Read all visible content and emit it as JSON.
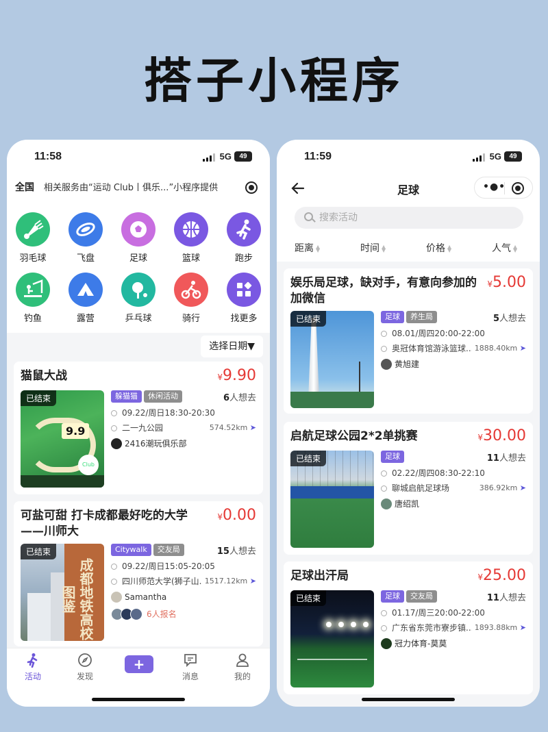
{
  "poster_title": "搭子小程序",
  "left": {
    "time": "11:58",
    "network": "5G",
    "battery": "49",
    "region": "全国",
    "notice": "相关服务由“运动 Club丨俱乐...”小程序提供",
    "categories": [
      {
        "label": "羽毛球",
        "icon": "badminton-icon",
        "color": "#2fbf7a"
      },
      {
        "label": "飞盘",
        "icon": "frisbee-icon",
        "color": "#3d7be8"
      },
      {
        "label": "足球",
        "icon": "soccer-ball-icon",
        "color": "#c86ee0"
      },
      {
        "label": "篮球",
        "icon": "basketball-icon",
        "color": "#7a58e2"
      },
      {
        "label": "跑步",
        "icon": "running-icon",
        "color": "#7a58e2"
      },
      {
        "label": "钓鱼",
        "icon": "fishing-icon",
        "color": "#2fbf7a"
      },
      {
        "label": "露营",
        "icon": "tent-icon",
        "color": "#3d7be8"
      },
      {
        "label": "乒乓球",
        "icon": "ping-pong-icon",
        "color": "#22b8a0"
      },
      {
        "label": "骑行",
        "icon": "cycling-icon",
        "color": "#f0585a"
      },
      {
        "label": "找更多",
        "icon": "grid-more-icon",
        "color": "#7a58e2"
      }
    ],
    "date_filter": "选择日期▼",
    "events": [
      {
        "title": "猫鼠大战",
        "price_symbol": "¥",
        "price": "9.90",
        "status": "已结束",
        "tags": [
          "躲猫猫",
          "休闲活动"
        ],
        "want_count": "6",
        "want_suffix": "人想去",
        "time": "09.22/周日18:30-20:30",
        "place": "二一九公园",
        "distance": "574.52km",
        "organizer": "2416潮玩俱乐部"
      },
      {
        "title": "可盐可甜 打卡成都最好吃的大学——川师大",
        "price_symbol": "¥",
        "price": "0.00",
        "status": "已结束",
        "tags": [
          "Citywalk",
          "交友局"
        ],
        "want_count": "15",
        "want_suffix": "人想去",
        "time": "09.22/周日15:05-20:05",
        "place": "四川师范大学(狮子山...",
        "distance": "1517.12km",
        "organizer": "Samantha",
        "signup_text": "6人报名",
        "poster_text": "成都地铁高校图鉴"
      }
    ],
    "tabs": [
      {
        "label": "活动",
        "icon": "activity-icon"
      },
      {
        "label": "发现",
        "icon": "compass-icon"
      },
      {
        "label": "消息",
        "icon": "message-icon"
      },
      {
        "label": "我的",
        "icon": "profile-icon"
      }
    ],
    "plus_label": "+"
  },
  "right": {
    "time": "11:59",
    "network": "5G",
    "battery": "49",
    "title": "足球",
    "search_placeholder": "搜索活动",
    "sorts": [
      "距离",
      "时间",
      "价格",
      "人气"
    ],
    "events": [
      {
        "title": "娱乐局足球，缺对手，有意向参加的加微信",
        "price_symbol": "¥",
        "price": "5.00",
        "status": "已结束",
        "tags": [
          "足球",
          "养生局"
        ],
        "want_count": "5",
        "want_suffix": "人想去",
        "time": "08.01/周四20:00-22:00",
        "place": "奥冠体育馆游泳篮球...",
        "distance": "1888.40km",
        "organizer": "黄旭建"
      },
      {
        "title": "启航足球公园2*2单挑赛",
        "price_symbol": "¥",
        "price": "30.00",
        "status": "已结束",
        "tags": [
          "足球"
        ],
        "want_count": "11",
        "want_suffix": "人想去",
        "time": "02.22/周四08:30-22:10",
        "place": "聊城启航足球场",
        "distance": "386.92km",
        "organizer": "唐绍凯"
      },
      {
        "title": "足球出汗局",
        "price_symbol": "¥",
        "price": "25.00",
        "status": "已结束",
        "tags": [
          "足球",
          "交友局"
        ],
        "want_count": "11",
        "want_suffix": "人想去",
        "time": "01.17/周三20:00-22:00",
        "place": "广东省东莞市寮步镇...",
        "distance": "1893.88km",
        "organizer": "冠力体育-莫莫"
      }
    ]
  }
}
